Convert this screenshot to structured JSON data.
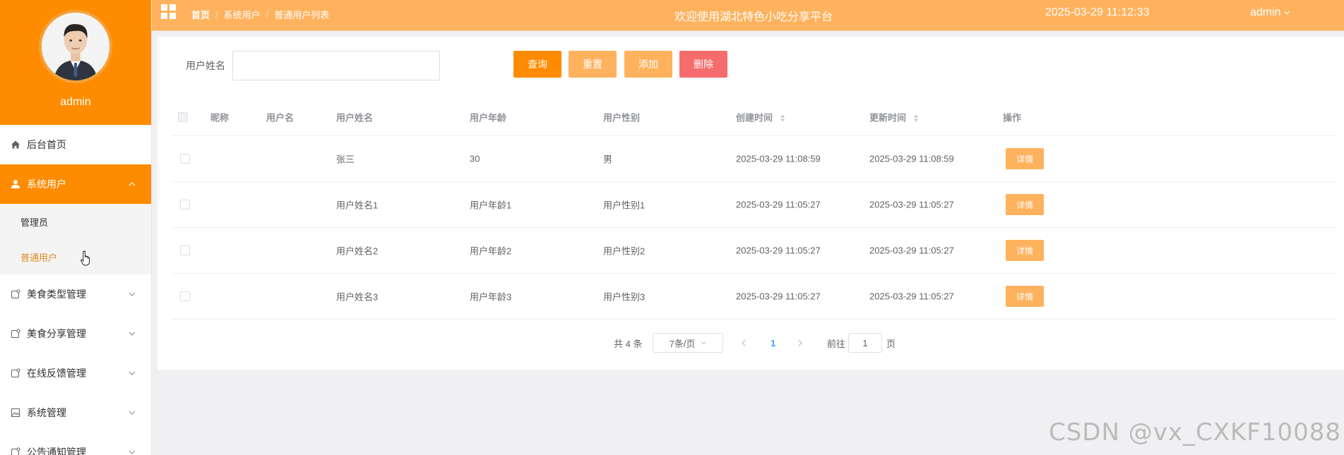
{
  "sidebar": {
    "profile_name": "admin",
    "items": [
      {
        "label": "后台首页",
        "icon": "home-icon"
      },
      {
        "label": "系统用户",
        "icon": "user-icon",
        "active": true,
        "expanded": true,
        "children": [
          {
            "label": "管理员"
          },
          {
            "label": "普通用户",
            "current": true
          }
        ]
      },
      {
        "label": "美食类型管理",
        "icon": "tag-icon"
      },
      {
        "label": "美食分享管理",
        "icon": "tag-icon"
      },
      {
        "label": "在线反馈管理",
        "icon": "tag-icon"
      },
      {
        "label": "系统管理",
        "icon": "image-icon"
      },
      {
        "label": "公告通知管理",
        "icon": "tag-icon"
      }
    ]
  },
  "header": {
    "breadcrumb": [
      "首页",
      "系统用户",
      "普通用户列表"
    ],
    "welcome": "欢迎使用湖北特色小吃分享平台",
    "datetime": "2025-03-29 11:12:33",
    "user": "admin"
  },
  "search": {
    "label": "用户姓名",
    "value": "",
    "buttons": {
      "query": "查询",
      "reset": "重置",
      "add": "添加",
      "delete": "删除"
    }
  },
  "table": {
    "columns": [
      "昵称",
      "用户名",
      "用户姓名",
      "用户年龄",
      "用户性别",
      "创建时间",
      "更新时间",
      "操作"
    ],
    "rows": [
      {
        "nickname": "",
        "username": "",
        "name": "张三",
        "age": "30",
        "gender": "男",
        "created": "2025-03-29 11:08:59",
        "updated": "2025-03-29 11:08:59",
        "action": "详情"
      },
      {
        "nickname": "",
        "username": "",
        "name": "用户姓名1",
        "age": "用户年龄1",
        "gender": "用户性别1",
        "created": "2025-03-29 11:05:27",
        "updated": "2025-03-29 11:05:27",
        "action": "详情"
      },
      {
        "nickname": "",
        "username": "",
        "name": "用户姓名2",
        "age": "用户年龄2",
        "gender": "用户性别2",
        "created": "2025-03-29 11:05:27",
        "updated": "2025-03-29 11:05:27",
        "action": "详情"
      },
      {
        "nickname": "",
        "username": "",
        "name": "用户姓名3",
        "age": "用户年龄3",
        "gender": "用户性别3",
        "created": "2025-03-29 11:05:27",
        "updated": "2025-03-29 11:05:27",
        "action": "详情"
      }
    ]
  },
  "pagination": {
    "total": "共 4 条",
    "page_size": "7条/页",
    "current_page": "1",
    "goto_label": "前往",
    "goto_value": "1",
    "page_suffix": "页"
  },
  "watermark": "CSDN @vx_CXKF10088",
  "colors": {
    "sidebar_accent": "#ff8c00",
    "header_bg": "#ffb25e",
    "query_button": "#ff8c00",
    "reset_button": "#ffb25e",
    "add_button": "#ffb25e",
    "delete_button": "#f56c6c",
    "current_page": "#409eff"
  }
}
